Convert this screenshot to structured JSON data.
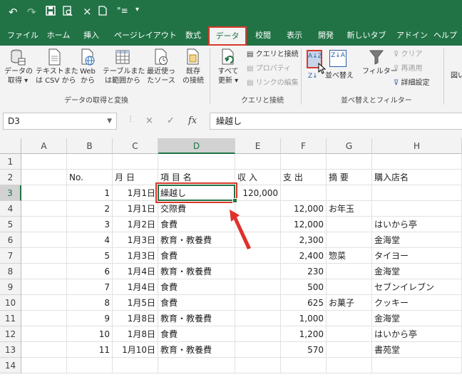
{
  "qat": {
    "undo": "↶",
    "redo": "↷",
    "save": "🖫",
    "preview": "🔍",
    "close": "×",
    "new": "🗋",
    "more": "≡",
    "customize": "▾"
  },
  "tabs": [
    {
      "label": "ファイル"
    },
    {
      "label": "ホーム"
    },
    {
      "label": "挿入"
    },
    {
      "label": "ページレイアウト"
    },
    {
      "label": "数式"
    },
    {
      "label": "データ"
    },
    {
      "label": "校閲"
    },
    {
      "label": "表示"
    },
    {
      "label": "開発"
    },
    {
      "label": "新しいタブ"
    },
    {
      "label": "アドイン"
    },
    {
      "label": "ヘルプ"
    }
  ],
  "active_tab": "データ",
  "ribbon": {
    "get_data": {
      "btn_get": "データの\n取得 ▾",
      "btn_text": "テキストまた\nは CSV から",
      "btn_web": "Web\nから",
      "btn_table": "テーブルまた\nは範囲から",
      "btn_recent": "最近使っ\nたソース",
      "btn_existing": "既存\nの接続",
      "label": "データの取得と変換"
    },
    "queries": {
      "refresh": "すべて\n更新 ▾",
      "queries_connections": "クエリと接続",
      "properties": "プロパティ",
      "edit_links": "リンクの編集",
      "label": "クエリと接続"
    },
    "sort_filter": {
      "sort_asc": "A↓Z",
      "sort_desc": "Z↓A",
      "sort": "並べ替え",
      "filter": "フィルター",
      "clear": "クリア",
      "reapply": "再適用",
      "advanced": "詳細設定",
      "label": "並べ替えとフィルター"
    },
    "right_cut": "図い"
  },
  "formula_bar": {
    "namebox": "D3",
    "cancel": "×",
    "enter": "✓",
    "fx": "fx",
    "content": "繰越し"
  },
  "columns": [
    "A",
    "B",
    "C",
    "D",
    "E",
    "F",
    "G",
    "H"
  ],
  "rows": [
    {
      "n": "1",
      "B": "",
      "C": "",
      "D": "",
      "E": "",
      "F": "",
      "G": "",
      "H": ""
    },
    {
      "n": "2",
      "B": "No.",
      "C": "月 日",
      "D": "項 目 名",
      "E": "収 入",
      "F": "支 出",
      "G": "摘 要",
      "H": "購入店名"
    },
    {
      "n": "3",
      "B": "1",
      "C": "1月1日",
      "D": "繰越し",
      "E": "120,000",
      "F": "",
      "G": "",
      "H": ""
    },
    {
      "n": "4",
      "B": "2",
      "C": "1月1日",
      "D": "交際費",
      "E": "",
      "F": "12,000",
      "G": "お年玉",
      "H": ""
    },
    {
      "n": "5",
      "B": "3",
      "C": "1月2日",
      "D": "食費",
      "E": "",
      "F": "12,000",
      "G": "",
      "H": "はいから亭"
    },
    {
      "n": "6",
      "B": "4",
      "C": "1月3日",
      "D": "教育・教養費",
      "E": "",
      "F": "2,300",
      "G": "",
      "H": "金海堂"
    },
    {
      "n": "7",
      "B": "5",
      "C": "1月3日",
      "D": "食費",
      "E": "",
      "F": "2,400",
      "G": "惣菜",
      "H": "タイヨー"
    },
    {
      "n": "8",
      "B": "6",
      "C": "1月4日",
      "D": "教育・教養費",
      "E": "",
      "F": "230",
      "G": "",
      "H": "金海堂"
    },
    {
      "n": "9",
      "B": "7",
      "C": "1月4日",
      "D": "食費",
      "E": "",
      "F": "500",
      "G": "",
      "H": "セブンイレブン"
    },
    {
      "n": "10",
      "B": "8",
      "C": "1月5日",
      "D": "食費",
      "E": "",
      "F": "625",
      "G": "お菓子",
      "H": "クッキー"
    },
    {
      "n": "11",
      "B": "9",
      "C": "1月8日",
      "D": "教育・教養費",
      "E": "",
      "F": "1,000",
      "G": "",
      "H": "金海堂"
    },
    {
      "n": "12",
      "B": "10",
      "C": "1月8日",
      "D": "食費",
      "E": "",
      "F": "1,200",
      "G": "",
      "H": "はいから亭"
    },
    {
      "n": "13",
      "B": "11",
      "C": "1月10日",
      "D": "教育・教養費",
      "E": "",
      "F": "570",
      "G": "",
      "H": "書苑堂"
    },
    {
      "n": "14",
      "B": "",
      "C": "",
      "D": "",
      "E": "",
      "F": "",
      "G": "",
      "H": ""
    }
  ],
  "colors": {
    "excel_green": "#217346",
    "highlight_red": "#d9392b"
  }
}
